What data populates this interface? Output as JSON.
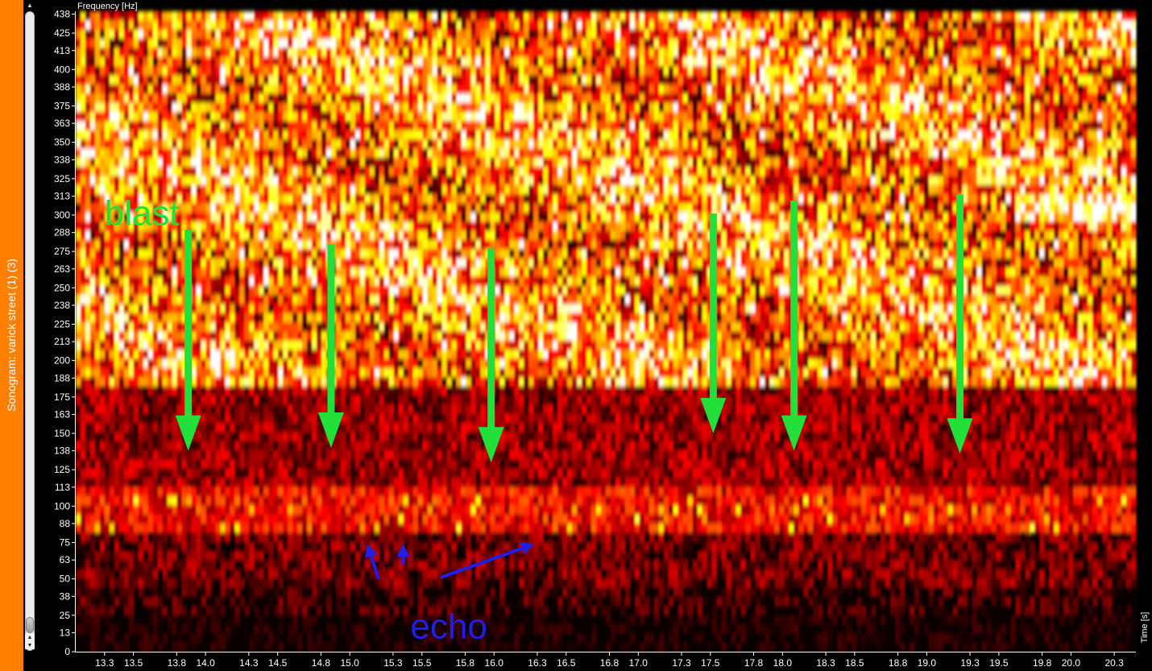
{
  "window": {
    "title": "Sonogram: varick street (1) (3)"
  },
  "colors": {
    "title_strip": "#ff7f00",
    "blast_annotation": "#22e03a",
    "echo_annotation": "#1f1fe8",
    "background": "#000000"
  },
  "icons": {
    "scroll_up": "triangle-up-icon",
    "scroll_down": "triangle-down-icon"
  },
  "scrollbar": {
    "up_arrow": "▲",
    "down_arrow": "▼",
    "top_arrow": "▲"
  },
  "chart_data": {
    "type": "heatmap",
    "title": "",
    "ylabel": "Frequency [Hz]",
    "xlabel": "Time [s]",
    "colormap": "hot",
    "xlim": [
      13.1,
      20.45
    ],
    "ylim": [
      0,
      440
    ],
    "yticks": [
      "0",
      "13",
      "25",
      "38",
      "50",
      "63",
      "75",
      "88",
      "100",
      "113",
      "125",
      "138",
      "150",
      "163",
      "175",
      "188",
      "200",
      "213",
      "225",
      "238",
      "250",
      "263",
      "275",
      "288",
      "300",
      "313",
      "325",
      "338",
      "350",
      "363",
      "375",
      "388",
      "400",
      "413",
      "425",
      "438"
    ],
    "xticks": [
      "13.3",
      "13.5",
      "13.8",
      "14.0",
      "14.3",
      "14.5",
      "14.8",
      "15.0",
      "15.3",
      "15.5",
      "15.8",
      "16.0",
      "16.3",
      "16.5",
      "16.8",
      "17.0",
      "17.3",
      "17.5",
      "17.8",
      "18.0",
      "18.3",
      "18.5",
      "18.8",
      "19.0",
      "19.3",
      "19.5",
      "19.8",
      "20.0",
      "20.3"
    ],
    "annotations": {
      "blast": {
        "label": "blast",
        "arrows": [
          {
            "x": 13.88,
            "y_from": 290,
            "y_to": 138
          },
          {
            "x": 14.87,
            "y_from": 280,
            "y_to": 140
          },
          {
            "x": 15.98,
            "y_from": 277,
            "y_to": 130
          },
          {
            "x": 17.52,
            "y_from": 301,
            "y_to": 150
          },
          {
            "x": 18.08,
            "y_from": 310,
            "y_to": 138
          },
          {
            "x": 19.23,
            "y_from": 314,
            "y_to": 136
          }
        ]
      },
      "echo": {
        "label": "echo",
        "arrows": [
          {
            "x_from": 15.2,
            "y_from": 50,
            "x_to": 15.12,
            "y_to": 74
          },
          {
            "x_from": 15.37,
            "y_from": 60,
            "x_to": 15.37,
            "y_to": 74
          },
          {
            "x_from": 15.63,
            "y_from": 51,
            "x_to": 16.28,
            "y_to": 74
          }
        ]
      }
    }
  }
}
